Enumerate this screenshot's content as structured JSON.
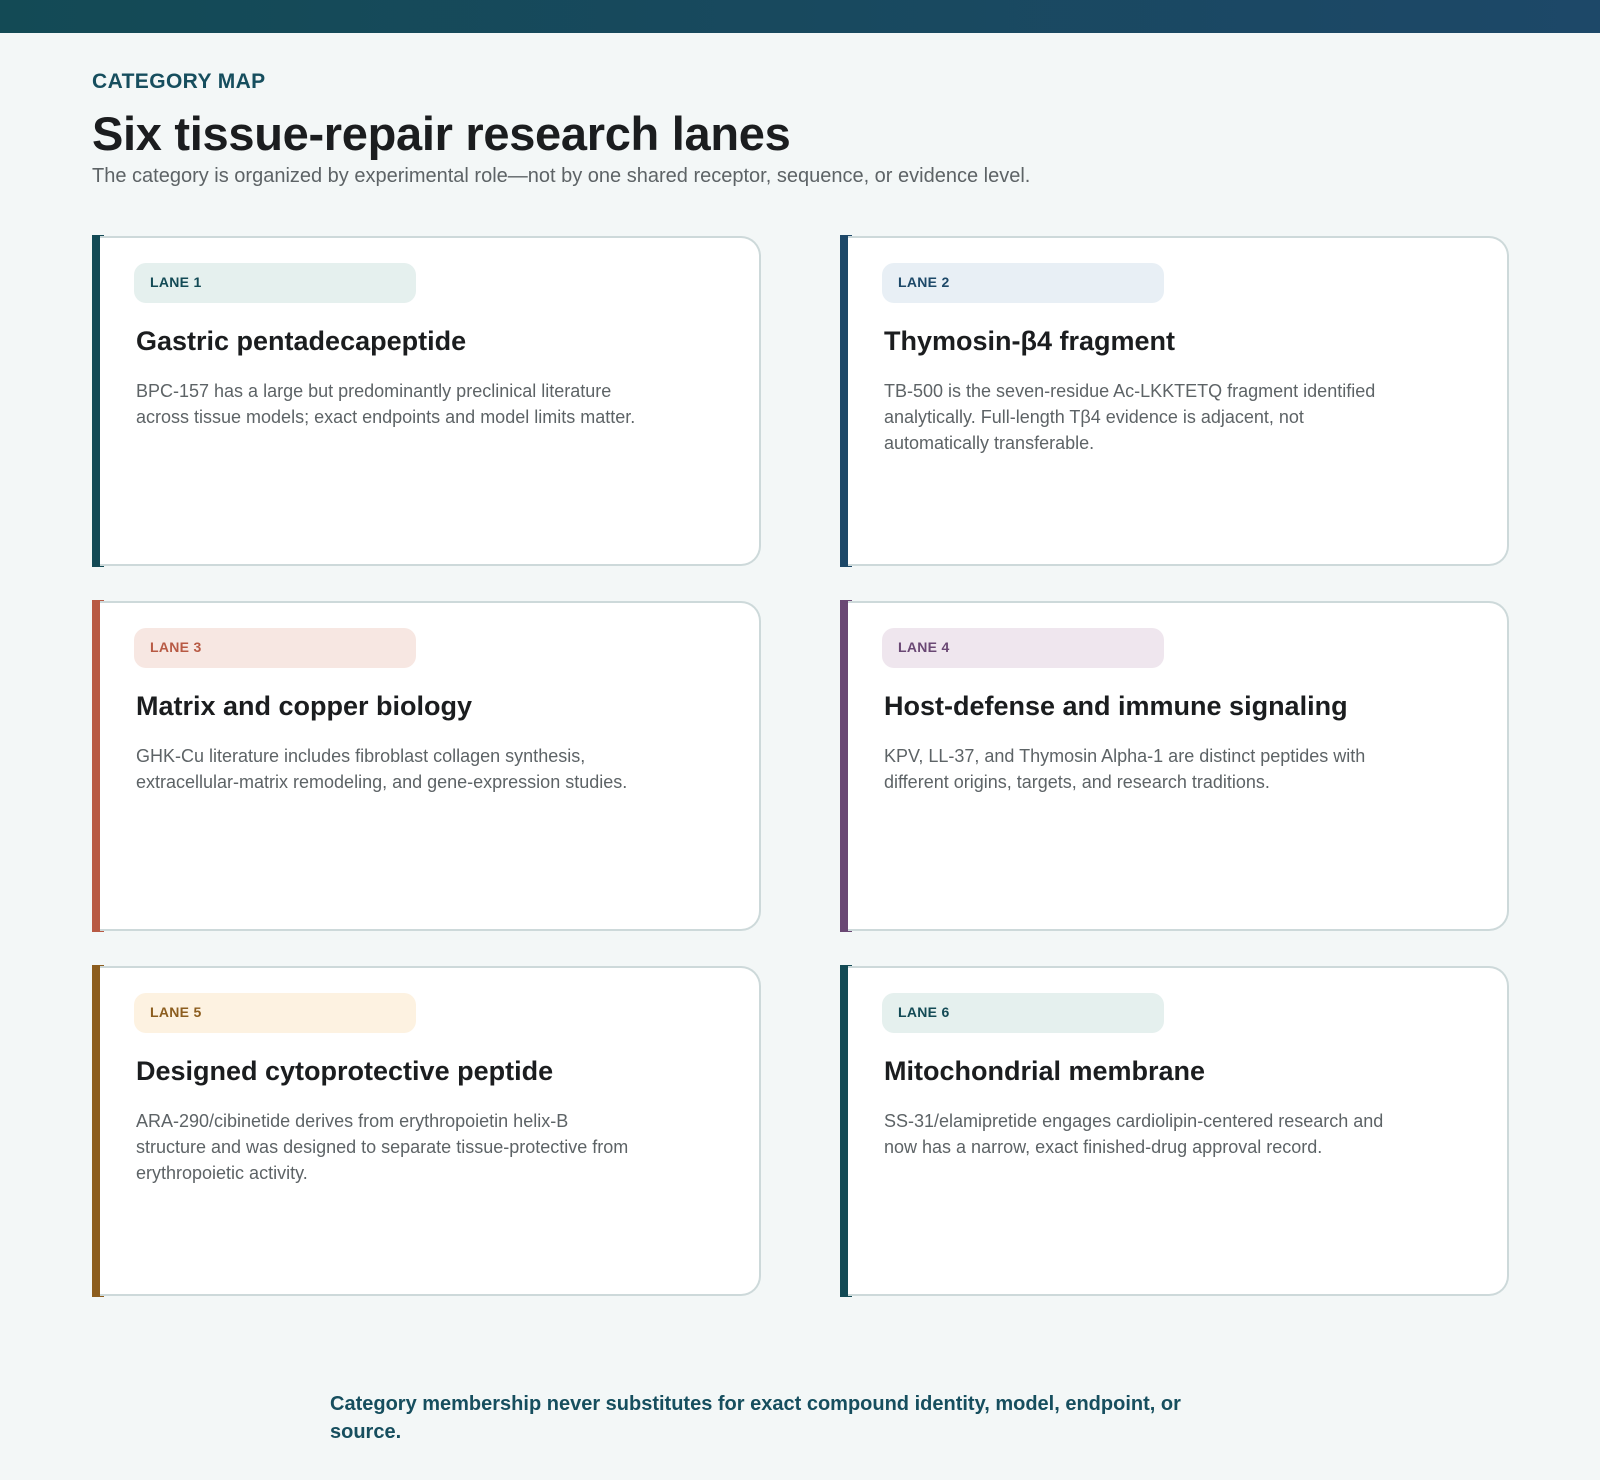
{
  "header": {
    "eyebrow": "CATEGORY MAP",
    "title": "Six tissue-repair research lanes",
    "subtitle": "The category is organized by experimental role—not by one shared receptor, sequence, or evidence level."
  },
  "lanes": [
    {
      "badge": "LANE 1",
      "title": "Gastric pentadecapeptide",
      "body": "BPC-157 has a large but predominantly preclinical literature across tissue models; exact endpoints and model limits matter.",
      "accent_color": "#134a55",
      "badge_bg": "#e5f0ee",
      "badge_color": "#134a55"
    },
    {
      "badge": "LANE 2",
      "title": "Thymosin-β4 fragment",
      "body": "TB-500 is the seven-residue Ac-LKKTETQ fragment identified analytically. Full-length Tβ4 evidence is adjacent, not automatically transferable.",
      "accent_color": "#1d4868",
      "badge_bg": "#e8eff5",
      "badge_color": "#1d4868"
    },
    {
      "badge": "LANE 3",
      "title": "Matrix and copper biology",
      "body": "GHK-Cu literature includes fibroblast collagen synthesis, extracellular-matrix remodeling, and gene-expression studies.",
      "accent_color": "#b85a44",
      "badge_bg": "#f7e7e2",
      "badge_color": "#b85a44"
    },
    {
      "badge": "LANE 4",
      "title": "Host-defense and immune signaling",
      "body": "KPV, LL-37, and Thymosin Alpha-1 are distinct peptides with different origins, targets, and research traditions.",
      "accent_color": "#6a4874",
      "badge_bg": "#efe6ee",
      "badge_color": "#6a4874"
    },
    {
      "badge": "LANE 5",
      "title": "Designed cytoprotective peptide",
      "body": "ARA-290/cibinetide derives from erythropoietin helix-B structure and was designed to separate tissue-protective from erythropoietic activity.",
      "accent_color": "#8c5d1e",
      "badge_bg": "#fdf2e1",
      "badge_color": "#8c5d1e"
    },
    {
      "badge": "LANE 6",
      "title": "Mitochondrial membrane",
      "body": "SS-31/elamipretide engages cardiolipin-centered research and now has a narrow, exact finished-drug approval record.",
      "accent_color": "#134a55",
      "badge_bg": "#e5f0ee",
      "badge_color": "#134a55"
    }
  ],
  "footer": {
    "note": "Category membership never substitutes for exact compound identity, model, endpoint, or source."
  }
}
